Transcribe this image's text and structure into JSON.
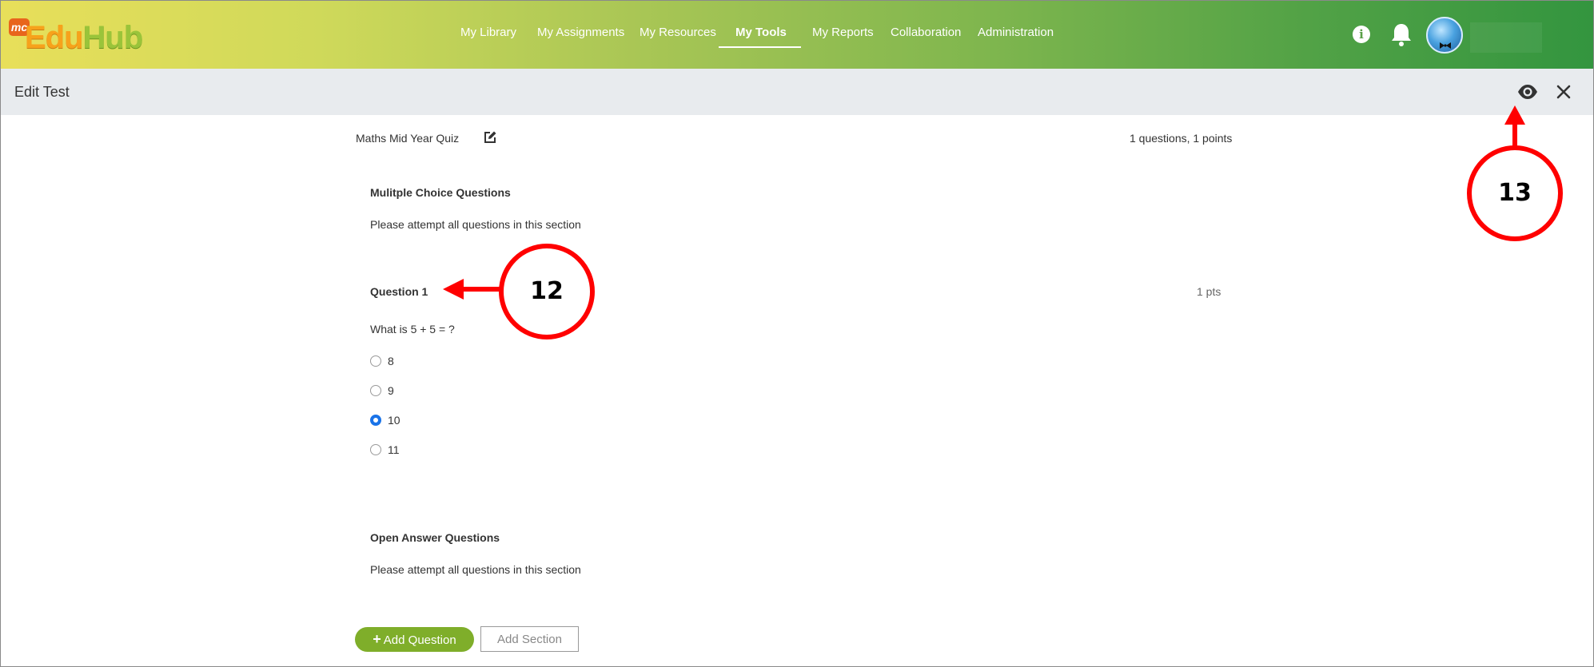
{
  "app": {
    "logo_badge": "mc",
    "logo_edu": "Edu",
    "logo_hub": "Hub"
  },
  "nav": {
    "items": [
      {
        "label": "My Library"
      },
      {
        "label": "My Assignments"
      },
      {
        "label": "My Resources"
      },
      {
        "label": "My Tools",
        "active": true
      },
      {
        "label": "My Reports"
      },
      {
        "label": "Collaboration"
      },
      {
        "label": "Administration"
      }
    ]
  },
  "header_icons": {
    "info": "i"
  },
  "subbar": {
    "title": "Edit Test"
  },
  "test": {
    "title": "Maths Mid Year Quiz",
    "summary": "1 questions, 1 points",
    "sections": [
      {
        "title": "Mulitple Choice Questions",
        "description": "Please attempt all questions in this section",
        "questions": [
          {
            "title": "Question 1",
            "points": "1 pts",
            "text": "What is 5 + 5 = ?",
            "options": [
              {
                "label": "8",
                "selected": false
              },
              {
                "label": "9",
                "selected": false
              },
              {
                "label": "10",
                "selected": true
              },
              {
                "label": "11",
                "selected": false
              }
            ]
          }
        ]
      },
      {
        "title": "Open Answer Questions",
        "description": "Please attempt all questions in this section"
      }
    ]
  },
  "buttons": {
    "add_question": "Add Question",
    "add_question_icon": "+",
    "add_section": "Add Section"
  },
  "callouts": {
    "question_label": "12",
    "preview_label": "13"
  },
  "colors": {
    "accent_green": "#7fae2a",
    "radio_selected": "#1a73e8",
    "callout_red": "#ff0000"
  }
}
